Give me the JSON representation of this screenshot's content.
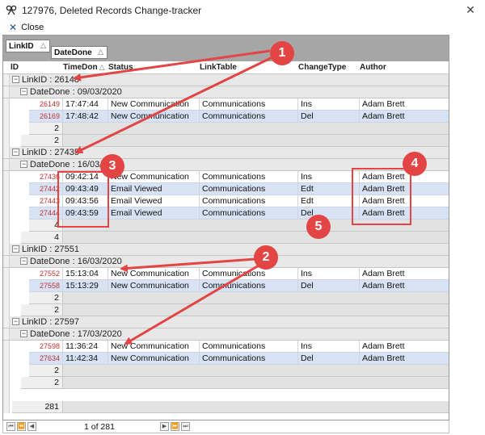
{
  "window": {
    "title": "127976, Deleted Records Change-tracker",
    "close_glyph": "✕"
  },
  "toolbar": {
    "close_label": "Close"
  },
  "group_panel": [
    {
      "label": "LinkID",
      "sort": "△"
    },
    {
      "label": "DateDone",
      "sort": "△"
    }
  ],
  "columns": {
    "id": "ID",
    "time": "TimeDon",
    "time_sort": "△",
    "status": "Status",
    "linktable": "LinkTable",
    "changetype": "ChangeType",
    "author": "Author"
  },
  "rows": [
    {
      "kind": "group1",
      "text": "LinkID : 26148"
    },
    {
      "kind": "group2",
      "text": "DateDone : 09/03/2020"
    },
    {
      "kind": "data",
      "id": "26149",
      "time": "17:47:44",
      "status": "New Communication",
      "linktable": "Communications",
      "changetype": "Ins",
      "author": "Adam Brett"
    },
    {
      "kind": "data",
      "id": "26169",
      "time": "17:48:42",
      "status": "New Communication",
      "linktable": "Communications",
      "changetype": "Del",
      "author": "Adam Brett"
    },
    {
      "kind": "footer2",
      "count": "2"
    },
    {
      "kind": "footer1",
      "count": "2"
    },
    {
      "kind": "group1",
      "text": "LinkID : 27435"
    },
    {
      "kind": "group2",
      "text": "DateDone : 16/03/2020"
    },
    {
      "kind": "data",
      "id": "27436",
      "time": "09:42:14",
      "status": "New Communication",
      "linktable": "Communications",
      "changetype": "Ins",
      "author": "Adam Brett"
    },
    {
      "kind": "data",
      "id": "27442",
      "time": "09:43:49",
      "status": "Email Viewed",
      "linktable": "Communications",
      "changetype": "Edt",
      "author": "Adam Brett"
    },
    {
      "kind": "data",
      "id": "27443",
      "time": "09:43:56",
      "status": "Email Viewed",
      "linktable": "Communications",
      "changetype": "Edt",
      "author": "Adam Brett"
    },
    {
      "kind": "data",
      "id": "27444",
      "time": "09:43:59",
      "status": "Email Viewed",
      "linktable": "Communications",
      "changetype": "Del",
      "author": "Adam Brett"
    },
    {
      "kind": "footer2",
      "count": "4"
    },
    {
      "kind": "footer1",
      "count": "4"
    },
    {
      "kind": "group1",
      "text": "LinkID : 27551"
    },
    {
      "kind": "group2",
      "text": "DateDone : 16/03/2020"
    },
    {
      "kind": "data",
      "id": "27552",
      "time": "15:13:04",
      "status": "New Communication",
      "linktable": "Communications",
      "changetype": "Ins",
      "author": "Adam Brett"
    },
    {
      "kind": "data",
      "id": "27558",
      "time": "15:13:29",
      "status": "New Communication",
      "linktable": "Communications",
      "changetype": "Del",
      "author": "Adam Brett"
    },
    {
      "kind": "footer2",
      "count": "2"
    },
    {
      "kind": "footer1",
      "count": "2"
    },
    {
      "kind": "group1",
      "text": "LinkID : 27597"
    },
    {
      "kind": "group2",
      "text": "DateDone : 17/03/2020"
    },
    {
      "kind": "data",
      "id": "27598",
      "time": "11:36:24",
      "status": "New Communication",
      "linktable": "Communications",
      "changetype": "Ins",
      "author": "Adam Brett"
    },
    {
      "kind": "data",
      "id": "27634",
      "time": "11:42:34",
      "status": "New Communication",
      "linktable": "Communications",
      "changetype": "Del",
      "author": "Adam Brett"
    },
    {
      "kind": "footer2",
      "count": "2"
    },
    {
      "kind": "footer1",
      "count": "2"
    },
    {
      "kind": "blank"
    },
    {
      "kind": "total",
      "count": "281"
    }
  ],
  "navigator": {
    "position": "1 of 281"
  },
  "annotations": {
    "badges": [
      "1",
      "2",
      "3",
      "4",
      "5"
    ],
    "color": "#e34545"
  }
}
